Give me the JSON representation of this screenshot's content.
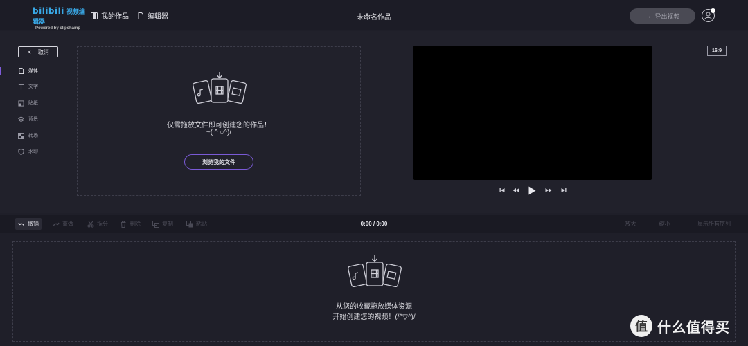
{
  "header": {
    "logo_text": "bilibili",
    "logo_suffix": "视频编辑器",
    "logo_sub": "Powered by clipchamp",
    "nav_my_works": "我的作品",
    "nav_editor": "编辑器",
    "doc_title": "未命名作品",
    "export_label": "导出视频"
  },
  "sidebar": {
    "cancel_label": "取消",
    "items": [
      {
        "label": "媒体",
        "icon": "file-icon"
      },
      {
        "label": "文字",
        "icon": "text-icon"
      },
      {
        "label": "贴纸",
        "icon": "sticker-icon"
      },
      {
        "label": "背景",
        "icon": "layers-icon"
      },
      {
        "label": "转场",
        "icon": "transition-icon"
      },
      {
        "label": "水印",
        "icon": "shield-icon"
      }
    ]
  },
  "upload": {
    "line1": "仅需拖放文件即可创建您的作品！",
    "line2": "~( ^ ○^)/",
    "browse_label": "浏览我的文件"
  },
  "preview": {
    "aspect_ratio": "16:9"
  },
  "toolbar": {
    "undo": "撤销",
    "redo": "重做",
    "split": "拆分",
    "delete": "删除",
    "duplicate": "复制",
    "paste": "粘贴",
    "timecode": "0:00 / 0:00",
    "zoom_in": "放大",
    "zoom_out": "缩小",
    "show_all": "显示所有序列"
  },
  "timeline": {
    "line1": "从您的收藏拖放媒体资源",
    "line2": "开始创建您的视频！(/^▽^)/"
  },
  "watermark": {
    "badge": "值",
    "text": "什么值得买"
  },
  "colors": {
    "accent": "#7a5ad6",
    "background": "#1f1f29",
    "logo": "#39a8e6"
  }
}
